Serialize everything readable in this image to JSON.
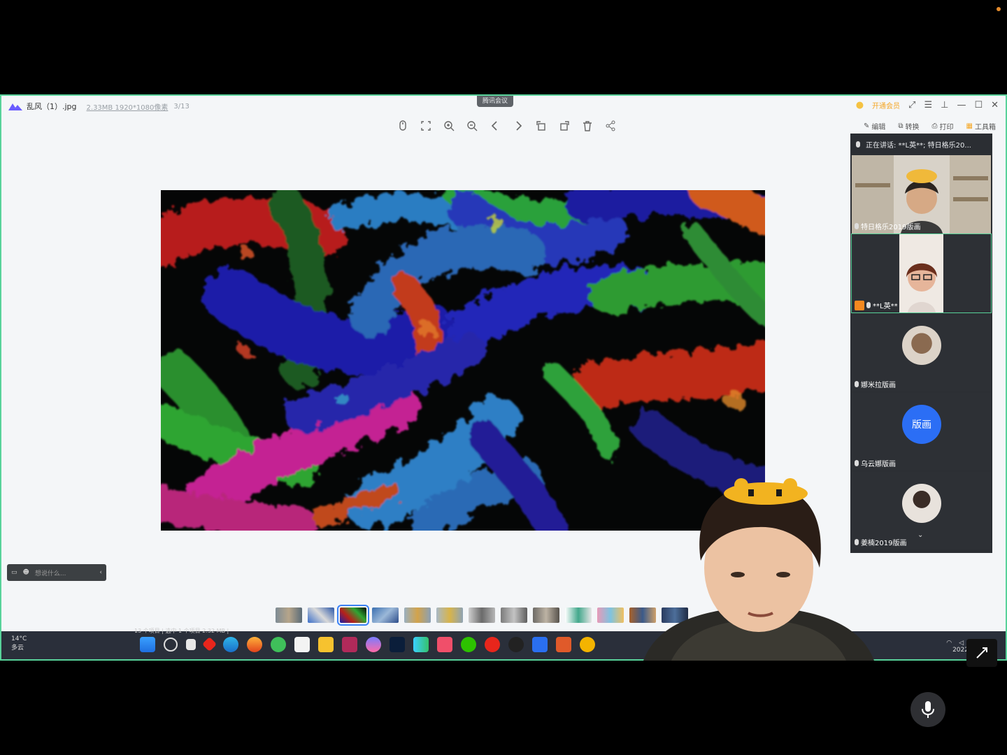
{
  "window": {
    "file_name": "乱风（1）.jpg",
    "file_meta": "2.33MB  1920*1080像素",
    "file_count": "3/13",
    "meeting_tag": "腾讯会议",
    "vip_label": "开通会员"
  },
  "toolbar": {
    "right": [
      {
        "label": "编辑",
        "icon": "edit-icon"
      },
      {
        "label": "转换",
        "icon": "convert-icon"
      },
      {
        "label": "打印",
        "icon": "print-icon"
      },
      {
        "label": "工具箱",
        "icon": "toolbox-icon"
      }
    ]
  },
  "panel": {
    "speaking": "正在讲话: **L英**; 特日格乐20...",
    "participants": [
      {
        "name": "特日格乐2019版画"
      },
      {
        "name": "**L英**"
      },
      {
        "name": "娜米拉版画"
      },
      {
        "name": "乌云娜版画",
        "avatar_text": "版画"
      },
      {
        "name": "姜楠2019版画"
      }
    ]
  },
  "mini_bar": {
    "placeholder": "想说什么..."
  },
  "taskbar": {
    "weather_temp": "14°C",
    "weather_desc": "多云",
    "status_strip": "13 个项目  |  选中 1 个项目  2.32 MB  |",
    "clock": "2022/"
  },
  "colors": {
    "accent": "#58d29a",
    "avatar_blue": "#2b6ef5"
  }
}
